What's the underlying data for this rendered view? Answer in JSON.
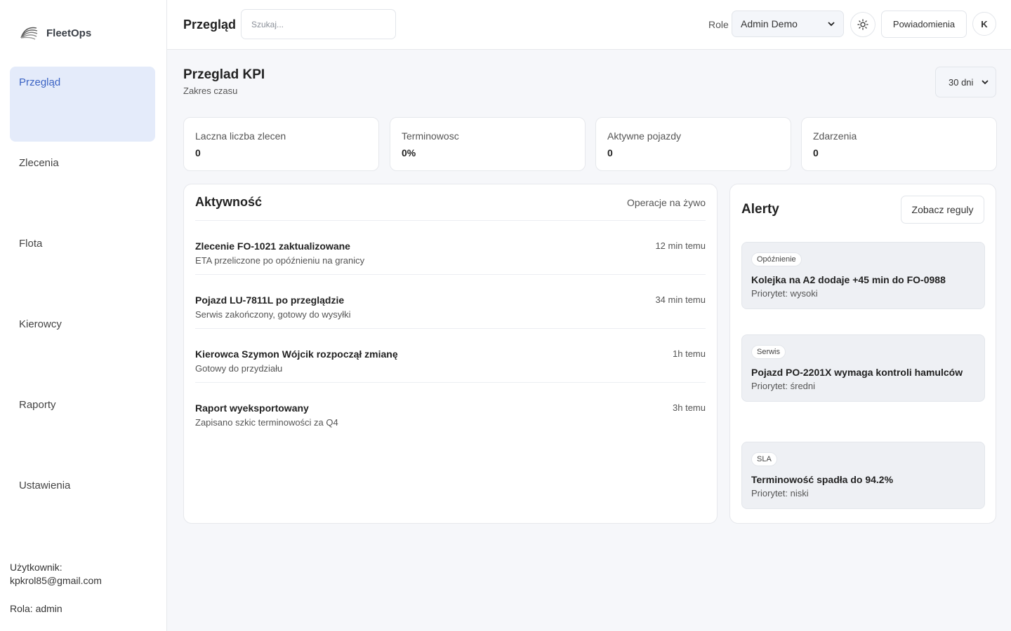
{
  "brand": {
    "name": "FleetOps"
  },
  "sidebar": {
    "items": [
      {
        "label": "Przegląd"
      },
      {
        "label": "Zlecenia"
      },
      {
        "label": "Flota"
      },
      {
        "label": "Kierowcy"
      },
      {
        "label": "Raporty"
      },
      {
        "label": "Ustawienia"
      }
    ],
    "user_label": "Użytkownik:",
    "user_email": "kpkrol85@gmail.com",
    "role": "Rola: admin"
  },
  "header": {
    "title": "Przegląd",
    "search_placeholder": "Szukaj...",
    "role_label": "Role",
    "role_value": "Admin Demo",
    "notifications_label": "Powiadomienia",
    "avatar_initial": "K"
  },
  "kpi": {
    "title": "Przeglad KPI",
    "subtitle": "Zakres czasu",
    "range": "30 dni",
    "stats": [
      {
        "label": "Laczna liczba zlecen",
        "value": "0"
      },
      {
        "label": "Terminowosc",
        "value": "0%"
      },
      {
        "label": "Aktywne pojazdy",
        "value": "0"
      },
      {
        "label": "Zdarzenia",
        "value": "0"
      }
    ]
  },
  "activity": {
    "title": "Aktywność",
    "live_label": "Operacje na żywo",
    "items": [
      {
        "title": "Zlecenie FO-1021 zaktualizowane",
        "desc": "ETA przeliczone po opóźnieniu na granicy",
        "time": "12 min temu"
      },
      {
        "title": "Pojazd LU-7811L po przeglądzie",
        "desc": "Serwis zakończony, gotowy do wysyłki",
        "time": "34 min temu"
      },
      {
        "title": "Kierowca Szymon Wójcik rozpoczął zmianę",
        "desc": "Gotowy do przydziału",
        "time": "1h temu"
      },
      {
        "title": "Raport wyeksportowany",
        "desc": "Zapisano szkic terminowości za Q4",
        "time": "3h temu"
      }
    ]
  },
  "alerts": {
    "title": "Alerty",
    "rules_button": "Zobacz reguly",
    "items": [
      {
        "tag": "Opóźnienie",
        "title": "Kolejka na A2 dodaje +45 min do FO-0988",
        "priority": "Priorytet: wysoki"
      },
      {
        "tag": "Serwis",
        "title": "Pojazd PO-2201X wymaga kontroli hamulców",
        "priority": "Priorytet: średni"
      },
      {
        "tag": "SLA",
        "title": "Terminowość spadła do 94.2%",
        "priority": "Priorytet: niski"
      }
    ]
  }
}
